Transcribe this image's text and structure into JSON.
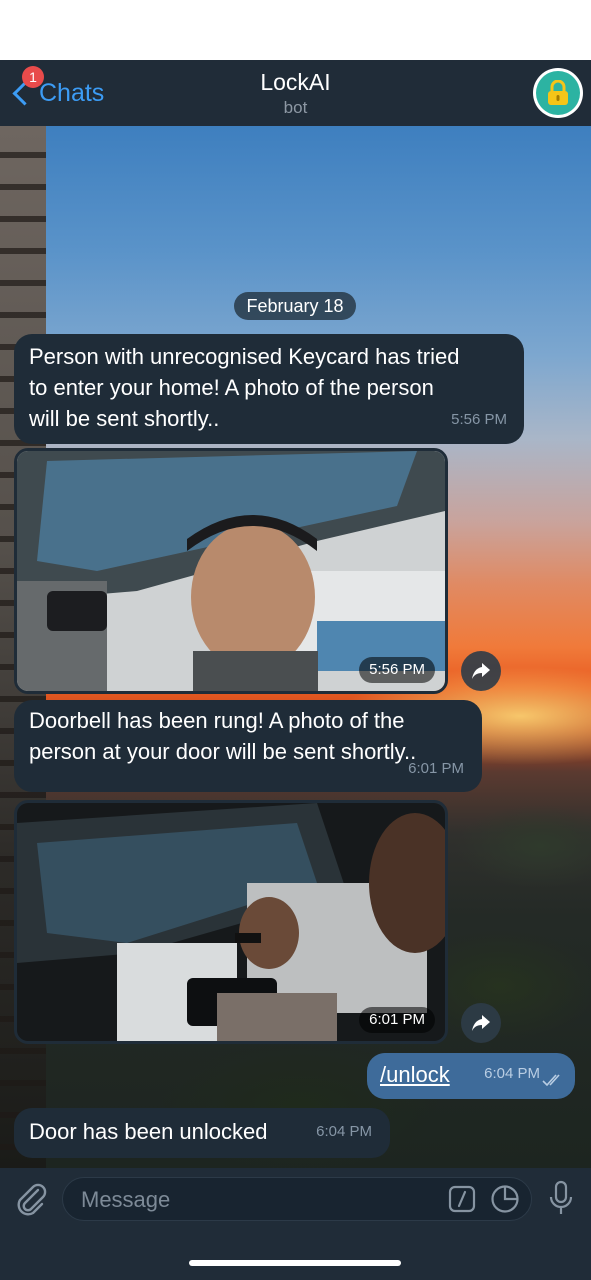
{
  "header": {
    "back_label": "Chats",
    "unread_badge": "1",
    "title": "LockAI",
    "subtitle": "bot",
    "avatar_icon": "lock-icon",
    "accent_color": "#3c9cf5"
  },
  "chat": {
    "date_separator": "February 18",
    "messages": [
      {
        "type": "text",
        "direction": "incoming",
        "lines": [
          "Person with unrecognised Keycard has tried",
          "to enter your home! A photo of the person",
          "will be sent shortly.."
        ],
        "time": "5:56 PM"
      },
      {
        "type": "photo",
        "direction": "incoming",
        "time": "5:56 PM",
        "action_icon": "share-icon"
      },
      {
        "type": "text",
        "direction": "incoming",
        "lines": [
          "Doorbell has been rung! A photo of the",
          "person at your door will be sent shortly.."
        ],
        "time": "6:01 PM"
      },
      {
        "type": "photo",
        "direction": "incoming",
        "time": "6:01 PM",
        "action_icon": "share-icon"
      },
      {
        "type": "text",
        "direction": "outgoing",
        "text": "/unlock",
        "time": "6:04 PM",
        "status_icon": "double-check-icon"
      },
      {
        "type": "text",
        "direction": "incoming",
        "text": "Door has been unlocked",
        "time": "6:04 PM"
      }
    ]
  },
  "composer": {
    "placeholder": "Message",
    "attach_icon": "paperclip-icon",
    "command_icon": "slash-command-icon",
    "sticker_icon": "sticker-icon",
    "mic_icon": "microphone-icon"
  }
}
